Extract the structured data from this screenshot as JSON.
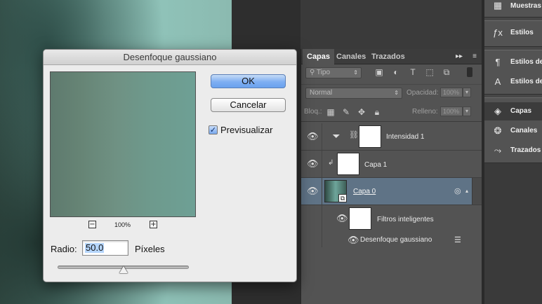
{
  "dialog": {
    "title": "Desenfoque gaussiano",
    "ok_label": "OK",
    "cancel_label": "Cancelar",
    "preview_label": "Previsualizar",
    "preview_checked": true,
    "zoom_out": "−",
    "zoom_in": "+",
    "zoom_level": "100%",
    "radius_label": "Radio:",
    "radius_value": "50.0",
    "radius_unit": "Píxeles",
    "radius_slider_fraction": 0.5
  },
  "layers_panel": {
    "tabs": [
      "Capas",
      "Canales",
      "Trazados"
    ],
    "filter_kind": "Tipo",
    "blend_mode": "Normal",
    "opacity_label": "Opacidad:",
    "opacity_value": "100%",
    "lock_label": "Bloq.:",
    "fill_label": "Relleno:",
    "fill_value": "100%",
    "layers": [
      {
        "name": "Intensidad 1",
        "type": "adjustment",
        "icon": "levels-icon"
      },
      {
        "name": "Capa 1",
        "type": "clipped"
      },
      {
        "name": "Capa 0",
        "type": "smart-object",
        "selected": true
      },
      {
        "name": "Filtros inteligentes",
        "type": "smart-filters"
      },
      {
        "name": "Desenfoque gaussiano",
        "type": "filter"
      }
    ]
  },
  "dock": {
    "items": [
      {
        "label": "Muestras",
        "icon": "swatches-icon"
      },
      {
        "label": "Estilos",
        "icon": "fx-styles-icon"
      },
      {
        "label": "Estilos de",
        "icon": "paragraph-styles-icon"
      },
      {
        "label": "Estilos de",
        "icon": "character-styles-icon"
      },
      {
        "label": "Capas",
        "icon": "layers-icon"
      },
      {
        "label": "Canales",
        "icon": "channels-icon"
      },
      {
        "label": "Trazados",
        "icon": "paths-icon"
      }
    ]
  },
  "colors": {
    "ok_button": "#7eaef2",
    "selected_layer": "#5f7386",
    "panel_bg": "#535353"
  }
}
